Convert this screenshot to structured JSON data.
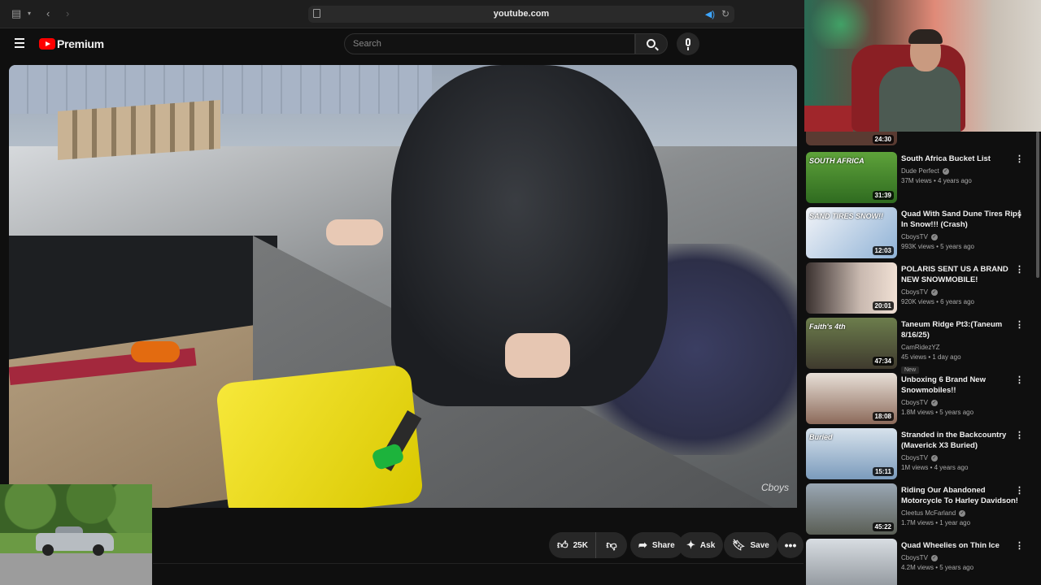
{
  "browser": {
    "url": "youtube.com"
  },
  "header": {
    "logo_text": "Premium",
    "search_placeholder": "Search"
  },
  "video": {
    "watermark": "Cboys"
  },
  "actions": {
    "like_count": "25K",
    "share_label": "Share",
    "ask_label": "Ask",
    "save_label": "Save"
  },
  "sidebar": {
    "partial_duration": "24:30",
    "items": [
      {
        "title": "South Africa Bucket List",
        "channel": "Dude Perfect",
        "verified": true,
        "meta": "37M views • 4 years ago",
        "duration": "31:39",
        "thumb_text": "SOUTH AFRICA"
      },
      {
        "title": "Quad With Sand Dune Tires Rips In Snow!!! (Crash)",
        "channel": "CboysTV",
        "verified": true,
        "meta": "993K views • 5 years ago",
        "duration": "12:03",
        "thumb_text": "SAND TIRES SNOW!!"
      },
      {
        "title": "POLARIS SENT US A BRAND NEW SNOWMOBILE!",
        "channel": "CboysTV",
        "verified": true,
        "meta": "920K views • 6 years ago",
        "duration": "20:01",
        "thumb_text": ""
      },
      {
        "title": "Taneum Ridge Pt3:(Taneum 8/16/25)",
        "channel": "CamRidezYZ",
        "verified": false,
        "meta": "45 views • 1 day ago",
        "badge": "New",
        "duration": "47:34",
        "thumb_text": "Faith's 4th"
      },
      {
        "title": "Unboxing 6 Brand New Snowmobiles!!",
        "channel": "CboysTV",
        "verified": true,
        "meta": "1.8M views • 5 years ago",
        "duration": "18:08",
        "thumb_text": ""
      },
      {
        "title": "Stranded in the Backcountry (Maverick X3 Buried)",
        "channel": "CboysTV",
        "verified": true,
        "meta": "1M views • 4 years ago",
        "duration": "15:11",
        "thumb_text": "Buried"
      },
      {
        "title": "Riding Our Abandoned Motorcycle To Harley Davidson!",
        "channel": "Cleetus McFarland",
        "verified": true,
        "meta": "1.7M views • 1 year ago",
        "duration": "45:22",
        "thumb_text": ""
      },
      {
        "title": "Quad Wheelies on Thin Ice",
        "channel": "CboysTV",
        "verified": true,
        "meta": "4.2M views • 5 years ago",
        "duration": "",
        "thumb_text": ""
      }
    ]
  }
}
